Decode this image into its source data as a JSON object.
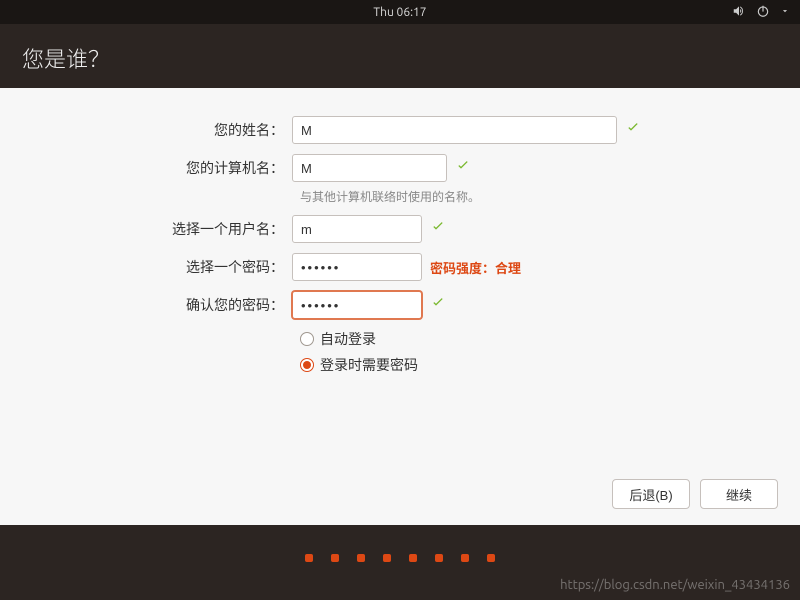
{
  "topbar": {
    "clock": "Thu 06:17"
  },
  "header": {
    "title": "您是谁？"
  },
  "form": {
    "name": {
      "label": "您的姓名：",
      "value": "M"
    },
    "hostname": {
      "label": "您的计算机名：",
      "value": "M",
      "hint": "与其他计算机联络时使用的名称。"
    },
    "username": {
      "label": "选择一个用户名：",
      "value": "m"
    },
    "password": {
      "label": "选择一个密码：",
      "value": "••••••",
      "strength": "密码强度：合理"
    },
    "confirm": {
      "label": "确认您的密码：",
      "value": "••••••"
    }
  },
  "options": {
    "auto_login": "自动登录",
    "require_password": "登录时需要密码"
  },
  "buttons": {
    "back": "后退(B)",
    "continue": "继续"
  },
  "watermark": "https://blog.csdn.net/weixin_43434136"
}
